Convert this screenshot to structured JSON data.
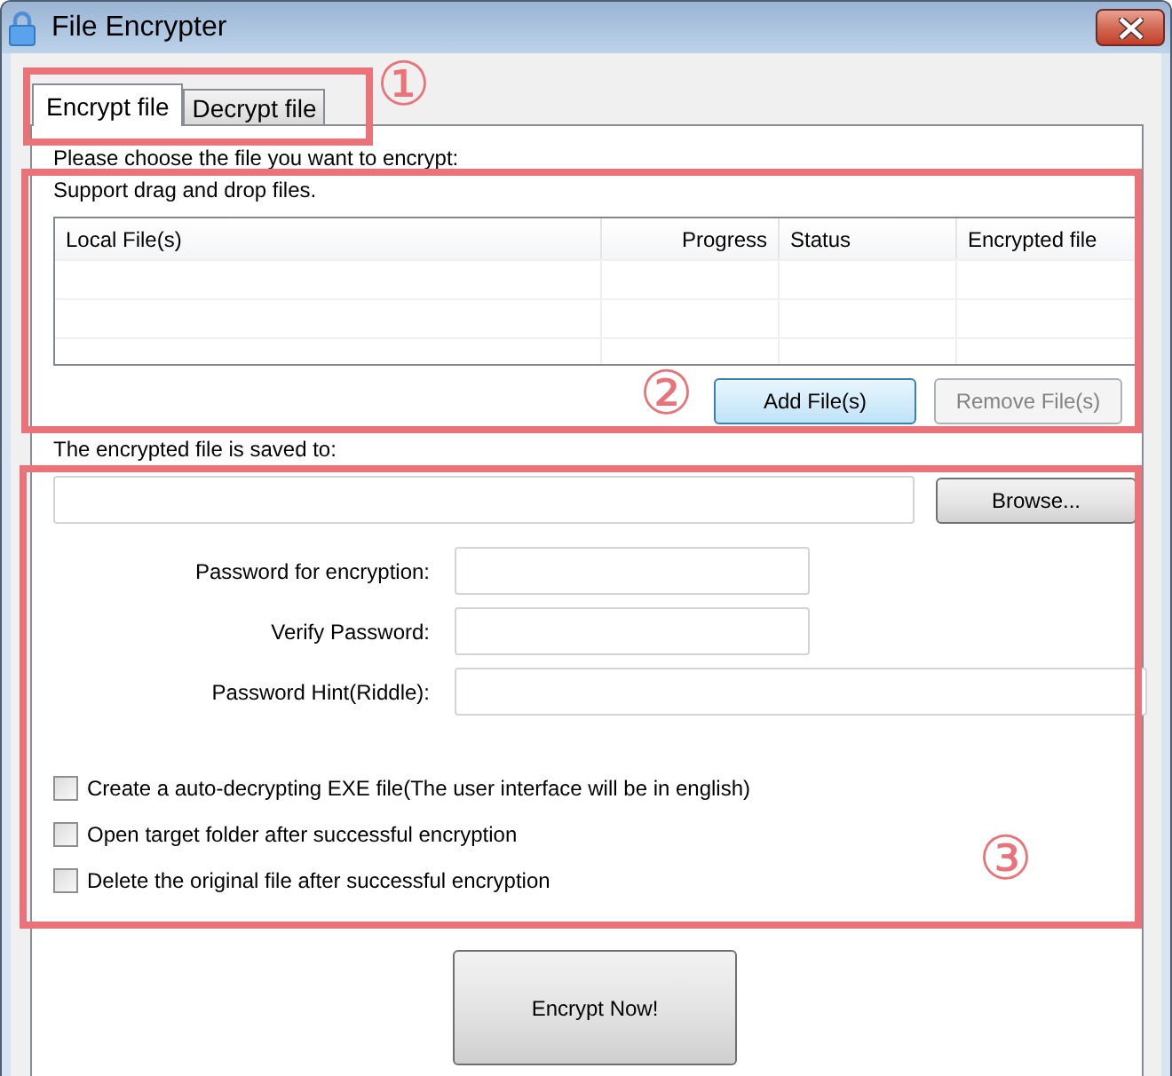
{
  "window": {
    "title": "File Encrypter"
  },
  "tabs": [
    {
      "label": "Encrypt file",
      "selected": true
    },
    {
      "label": "Decrypt file",
      "selected": false
    }
  ],
  "file_section": {
    "instruction": "Please choose the file you want to encrypt:",
    "hint": "Support drag and drop files.",
    "columns": [
      {
        "label": "Local File(s)"
      },
      {
        "label": "Progress"
      },
      {
        "label": "Status"
      },
      {
        "label": "Encrypted file"
      }
    ],
    "buttons": [
      {
        "label": "Add File(s)",
        "focused": true,
        "disabled": false
      },
      {
        "label": "Remove File(s)",
        "focused": false,
        "disabled": true
      }
    ]
  },
  "output": {
    "label": "The encrypted file is saved to:",
    "browse_button": "Browse..."
  },
  "password_fields": [
    {
      "kind": "password",
      "label": "Password for encryption:"
    },
    {
      "kind": "password",
      "label": "Verify Password:"
    },
    {
      "kind": "hint",
      "label": "Password Hint(Riddle):"
    }
  ],
  "options": [
    {
      "label": "Create a auto-decrypting EXE file(The user interface will be in english)",
      "checked": false
    },
    {
      "label": "Open target folder after successful encryption",
      "checked": false
    },
    {
      "label": "Delete the original file after successful encryption",
      "checked": false
    }
  ],
  "action_button": {
    "label": "Encrypt Now!"
  },
  "annotations": [
    {
      "label": "①"
    },
    {
      "label": "②"
    },
    {
      "label": "③"
    }
  ]
}
